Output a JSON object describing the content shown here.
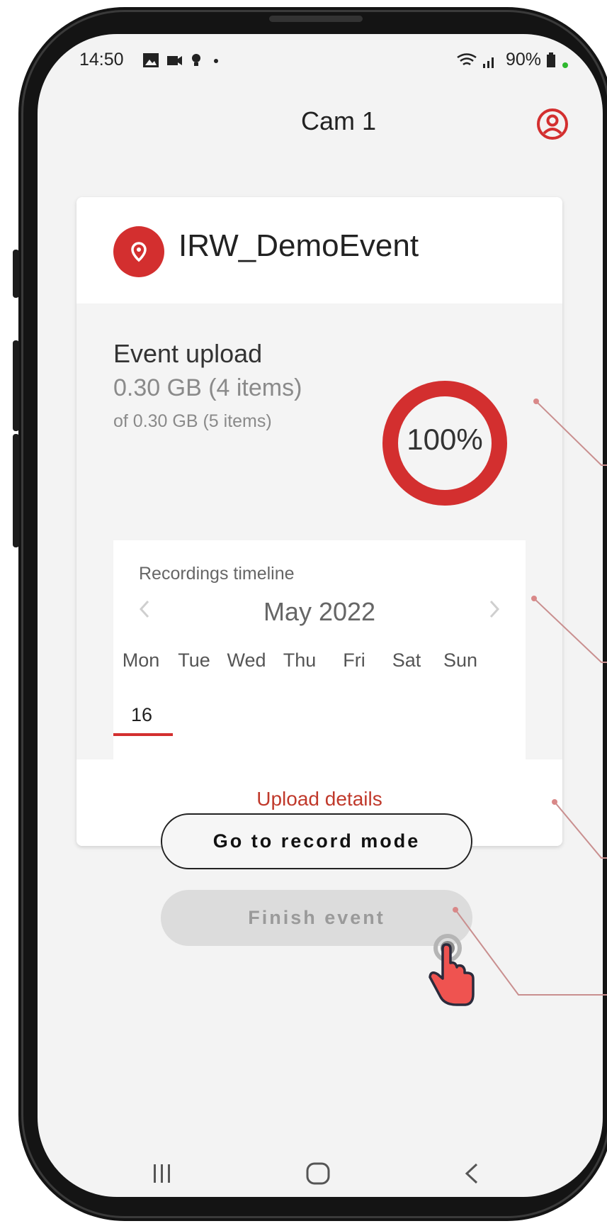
{
  "status_bar": {
    "time": "14:50",
    "notification_icons": [
      "image-icon",
      "video-icon",
      "location-icon",
      "dot-icon"
    ],
    "battery_percent": "90%"
  },
  "header": {
    "title": "Cam 1",
    "account_icon": "account-circle-icon"
  },
  "event": {
    "name": "IRW_DemoEvent",
    "icon": "location-pin-icon"
  },
  "upload": {
    "title": "Event upload",
    "uploaded": "0.30 GB (4 items)",
    "total": "of 0.30 GB (5 items)",
    "percent_label": "100%",
    "progress": 1.0
  },
  "timeline": {
    "title": "Recordings timeline",
    "month": "May 2022",
    "prev_icon": "chevron-left-icon",
    "next_icon": "chevron-right-icon",
    "days": [
      "Mon",
      "Tue",
      "Wed",
      "Thu",
      "Fri",
      "Sat",
      "Sun"
    ],
    "dates": [
      "16"
    ]
  },
  "upload_details_label": "Upload details",
  "buttons": {
    "record": "Go to record mode",
    "finish": "Finish event"
  },
  "navbar": [
    "recent-apps-icon",
    "home-icon",
    "back-icon"
  ],
  "colors": {
    "accent": "#d32f2f",
    "link": "#c0392b",
    "background": "#f3f3f3"
  }
}
